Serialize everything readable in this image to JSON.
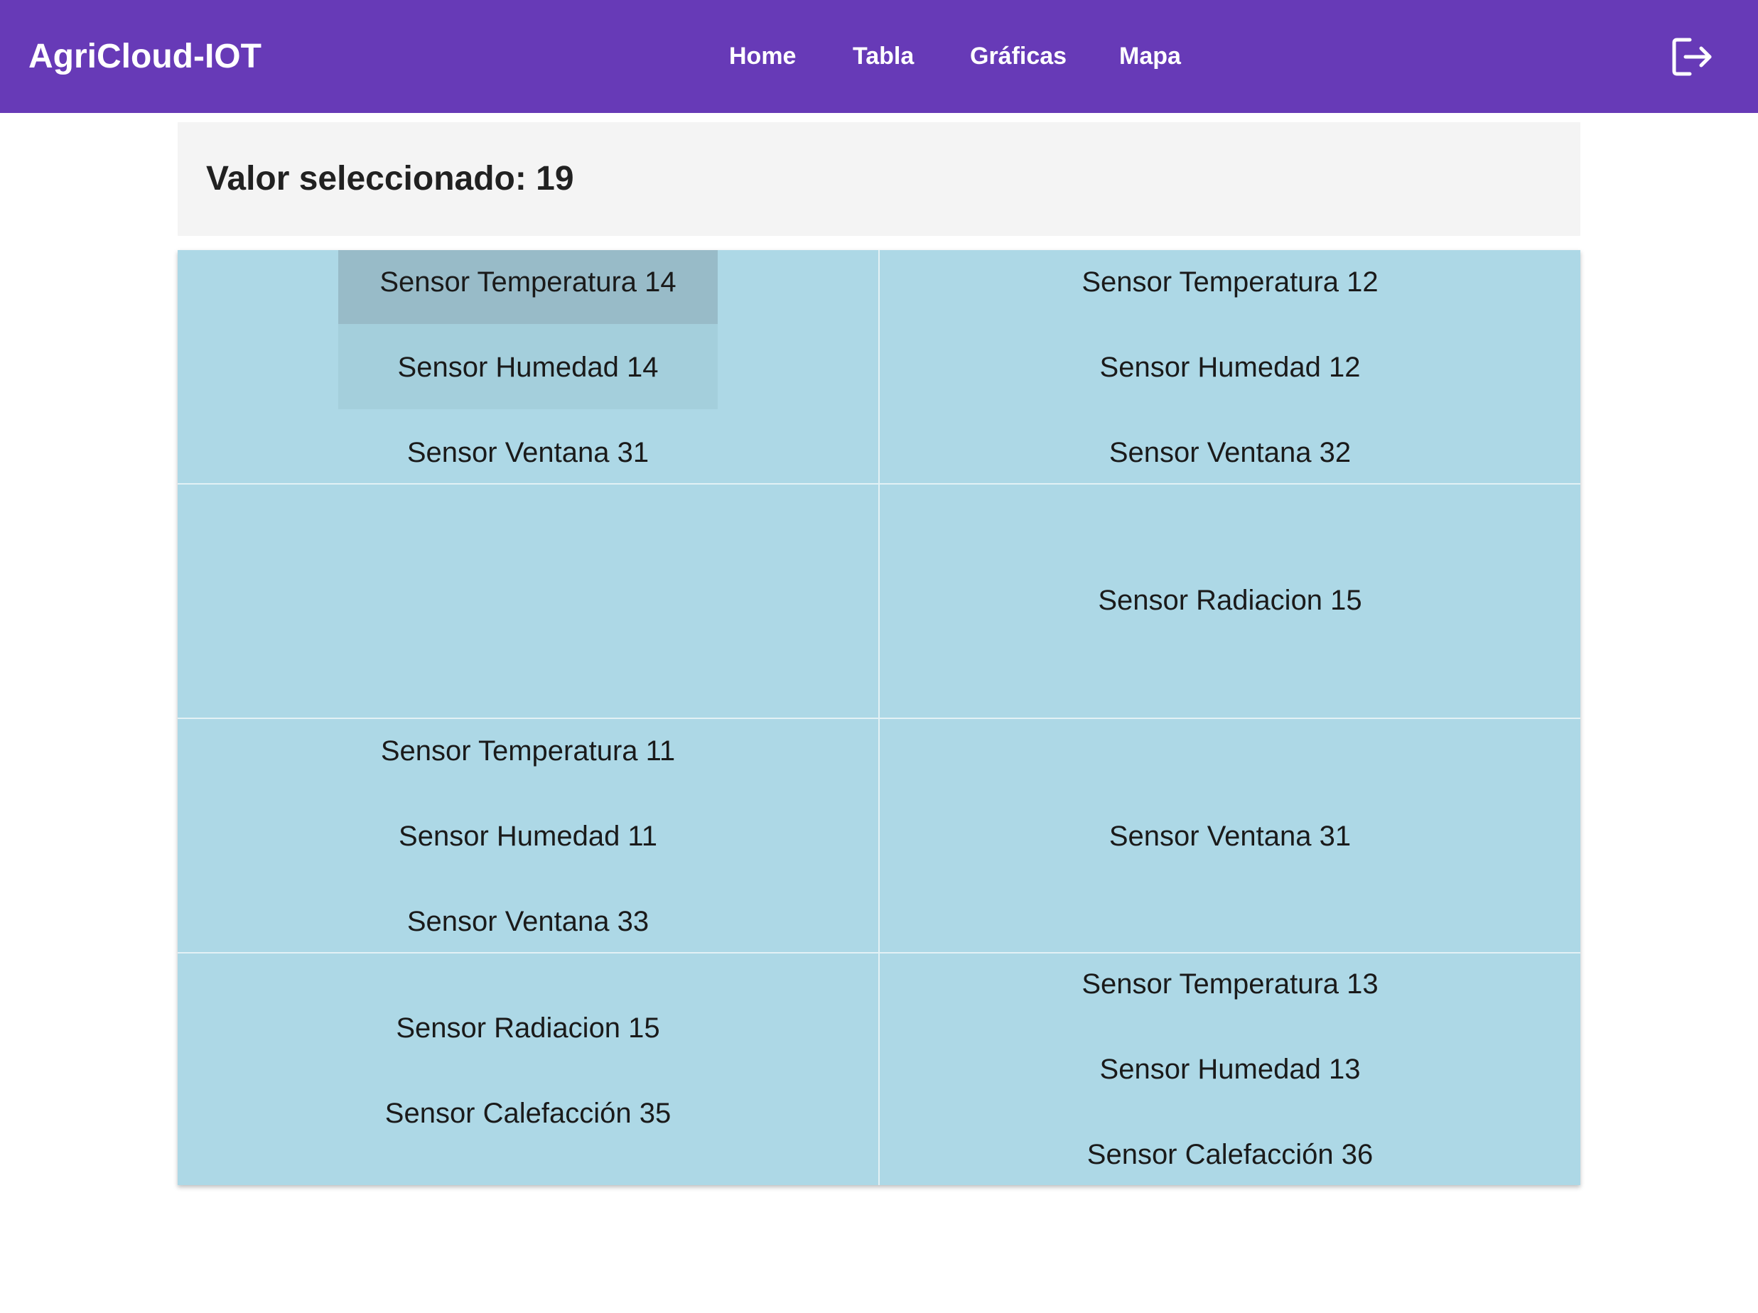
{
  "app": {
    "title": "AgriCloud-IOT"
  },
  "nav": {
    "items": [
      {
        "label": "Home"
      },
      {
        "label": "Tabla"
      },
      {
        "label": "Gráficas"
      },
      {
        "label": "Mapa"
      }
    ],
    "logout_icon": "logout-icon"
  },
  "header": {
    "selected_label": "Valor seleccionado: 19"
  },
  "grid": {
    "cells": [
      {
        "items": [
          "Sensor Temperatura 14",
          "Sensor Humedad 14",
          "Sensor Ventana 31"
        ]
      },
      {
        "items": [
          "Sensor Temperatura 12",
          "Sensor Humedad 12",
          "Sensor Ventana 32"
        ]
      },
      {
        "items": []
      },
      {
        "items": [
          "Sensor Radiacion 15"
        ]
      },
      {
        "items": [
          "Sensor Temperatura 11",
          "Sensor Humedad 11",
          "Sensor Ventana 33"
        ]
      },
      {
        "items": [
          "Sensor Ventana 31"
        ]
      },
      {
        "items": [
          "Sensor Radiacion 15",
          "Sensor Calefacción 35"
        ]
      },
      {
        "items": [
          "Sensor Temperatura 13",
          "Sensor Humedad 13",
          "Sensor Calefacción 36"
        ]
      }
    ]
  },
  "colors": {
    "toolbar": "#673ab7",
    "cell": "#add8e6",
    "hover": "#98bbc8",
    "focus": "#a4cfdc"
  }
}
